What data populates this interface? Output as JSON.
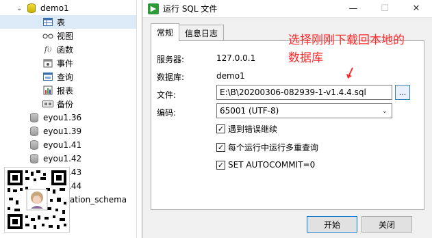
{
  "tree": {
    "db_name": "demo1",
    "children": [
      {
        "label": "表",
        "icon": "table-icon"
      },
      {
        "label": "视图",
        "icon": "view-icon"
      },
      {
        "label": "函数",
        "icon": "function-icon"
      },
      {
        "label": "事件",
        "icon": "event-icon"
      },
      {
        "label": "查询",
        "icon": "query-icon"
      },
      {
        "label": "报表",
        "icon": "report-icon"
      },
      {
        "label": "备份",
        "icon": "backup-icon"
      }
    ],
    "other_dbs": [
      "eyou1.36",
      "eyou1.39",
      "eyou1.41",
      "eyou1.42",
      "eyou1.43",
      "eyou1.44",
      "information_schema"
    ]
  },
  "dialog": {
    "title": "运行 SQL 文件",
    "tabs": [
      "常规",
      "信息日志"
    ],
    "server_label": "服务器:",
    "server_value": "127.0.0.1",
    "db_label": "数据库:",
    "db_value": "demo1",
    "file_label": "文件:",
    "file_value": "E:\\B\\20200306-082939-1-v1.4.4.sql",
    "browse_label": "...",
    "encoding_label": "编码:",
    "encoding_value": "65001 (UTF-8)",
    "checkboxes": [
      {
        "label": "遇到错误继续",
        "checked": true
      },
      {
        "label": "每个运行中运行多重查询",
        "checked": true
      },
      {
        "label": "SET AUTOCOMMIT=0",
        "checked": true
      }
    ],
    "start_button": "开始",
    "close_button": "关闭",
    "minimize_glyph": "—",
    "maximize_glyph": "☐",
    "close_glyph": "✕"
  },
  "annotation": {
    "line1": "选择刚刚下载回本地的",
    "line2": "数据库",
    "color": "#ff2a2a"
  }
}
